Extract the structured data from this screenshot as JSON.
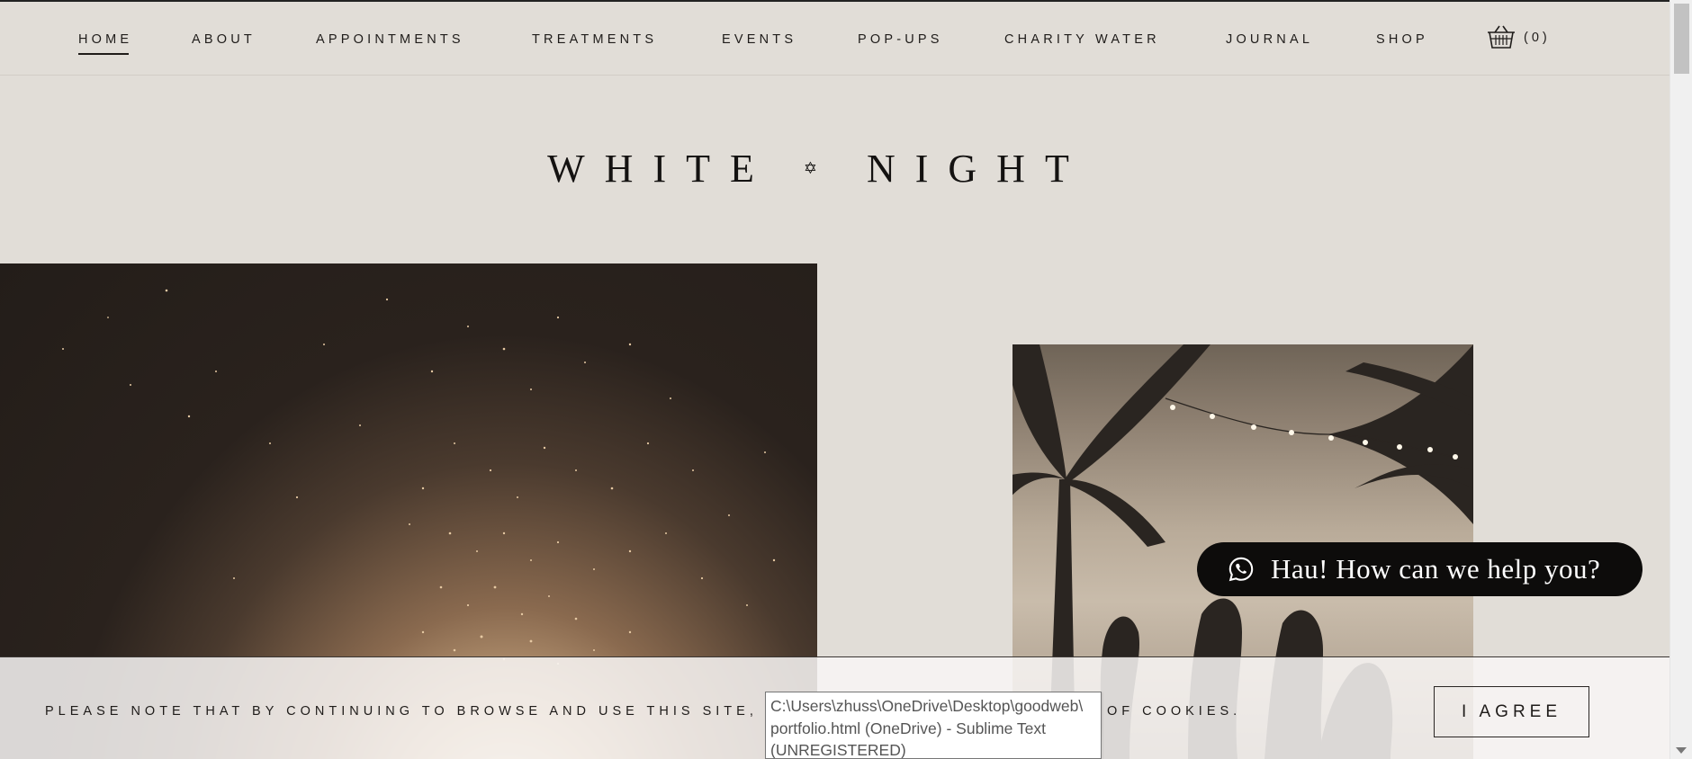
{
  "nav": {
    "items": [
      {
        "label": "HOME",
        "active": true
      },
      {
        "label": "ABOUT"
      },
      {
        "label": "APPOINTMENTS"
      },
      {
        "label": "TREATMENTS"
      },
      {
        "label": "EVENTS"
      },
      {
        "label": "POP-UPS"
      },
      {
        "label": "CHARITY WATER"
      },
      {
        "label": "JOURNAL"
      },
      {
        "label": "SHOP"
      }
    ],
    "cart_icon": "basket-icon",
    "cart_count": "(0)"
  },
  "logo": {
    "word1": "WHITE",
    "separator": "✡",
    "word2": "NIGHT"
  },
  "images": {
    "left": "bonfire-sparks-photo",
    "right": "palm-trees-string-lights-photo"
  },
  "whatsapp": {
    "icon": "whatsapp-icon",
    "text": "Hau! How can we help you?"
  },
  "cookie": {
    "text_before": "PLEASE NOTE THAT BY CONTINUING TO BROWSE AND USE THIS SITE,",
    "text_after": "OF COOKIES.",
    "agree_label": "I AGREE"
  },
  "tooltip": {
    "line1": "C:\\Users\\zhuss\\OneDrive\\Desktop\\goodweb\\",
    "line2": "portfolio.html (OneDrive) - Sublime Text",
    "line3": "(UNREGISTERED)"
  },
  "colors": {
    "background": "#e1ddd7",
    "text": "#1b1817",
    "whatsapp_bg": "#0d0c0b"
  }
}
